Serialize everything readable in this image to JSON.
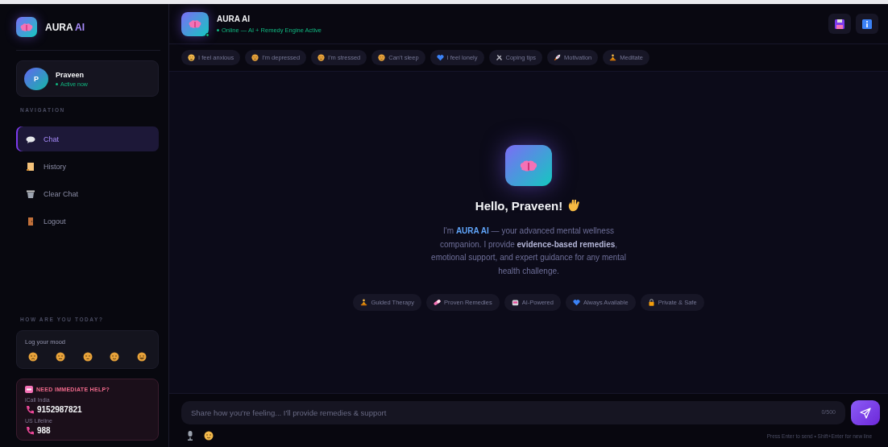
{
  "sidebar": {
    "brand": {
      "name": "AURA",
      "accent": "AI"
    },
    "user": {
      "initial": "P",
      "name": "Praveen",
      "status": "Active now"
    },
    "nav_heading": "NAVIGATION",
    "nav": [
      {
        "label": "Chat",
        "selected": true
      },
      {
        "label": "History",
        "selected": false
      },
      {
        "label": "Clear Chat",
        "selected": false
      },
      {
        "label": "Logout",
        "selected": false
      }
    ],
    "mood_heading": "HOW ARE YOU TODAY?",
    "mood": {
      "label": "Log your mood"
    },
    "help": {
      "title": "NEED IMMEDIATE HELP?",
      "lines": [
        {
          "label": "iCall India",
          "number": "9152987821"
        },
        {
          "label": "US Lifeline",
          "number": "988"
        }
      ]
    }
  },
  "header": {
    "title": "AURA AI",
    "status": "Online — AI + Remedy Engine Active"
  },
  "quick_replies": [
    "I feel anxious",
    "I'm depressed",
    "I'm stressed",
    "Can't sleep",
    "I feel lonely",
    "Coping tips",
    "Motivation",
    "Meditate"
  ],
  "welcome": {
    "title": "Hello, Praveen!",
    "message": "I'm **AURA AI** — your advanced mental wellness companion. I provide **evidence-based remedies**, emotional support, and expert guidance for any mental health challenge.",
    "features": [
      "Guided Therapy",
      "Proven Remedies",
      "AI-Powered",
      "Always Available",
      "Private & Safe"
    ]
  },
  "composer": {
    "placeholder": "Share how you're feeling... I'll provide remedies & support",
    "counter": "0/500",
    "hint": "Press Enter to send • Shift+Enter for new line"
  }
}
